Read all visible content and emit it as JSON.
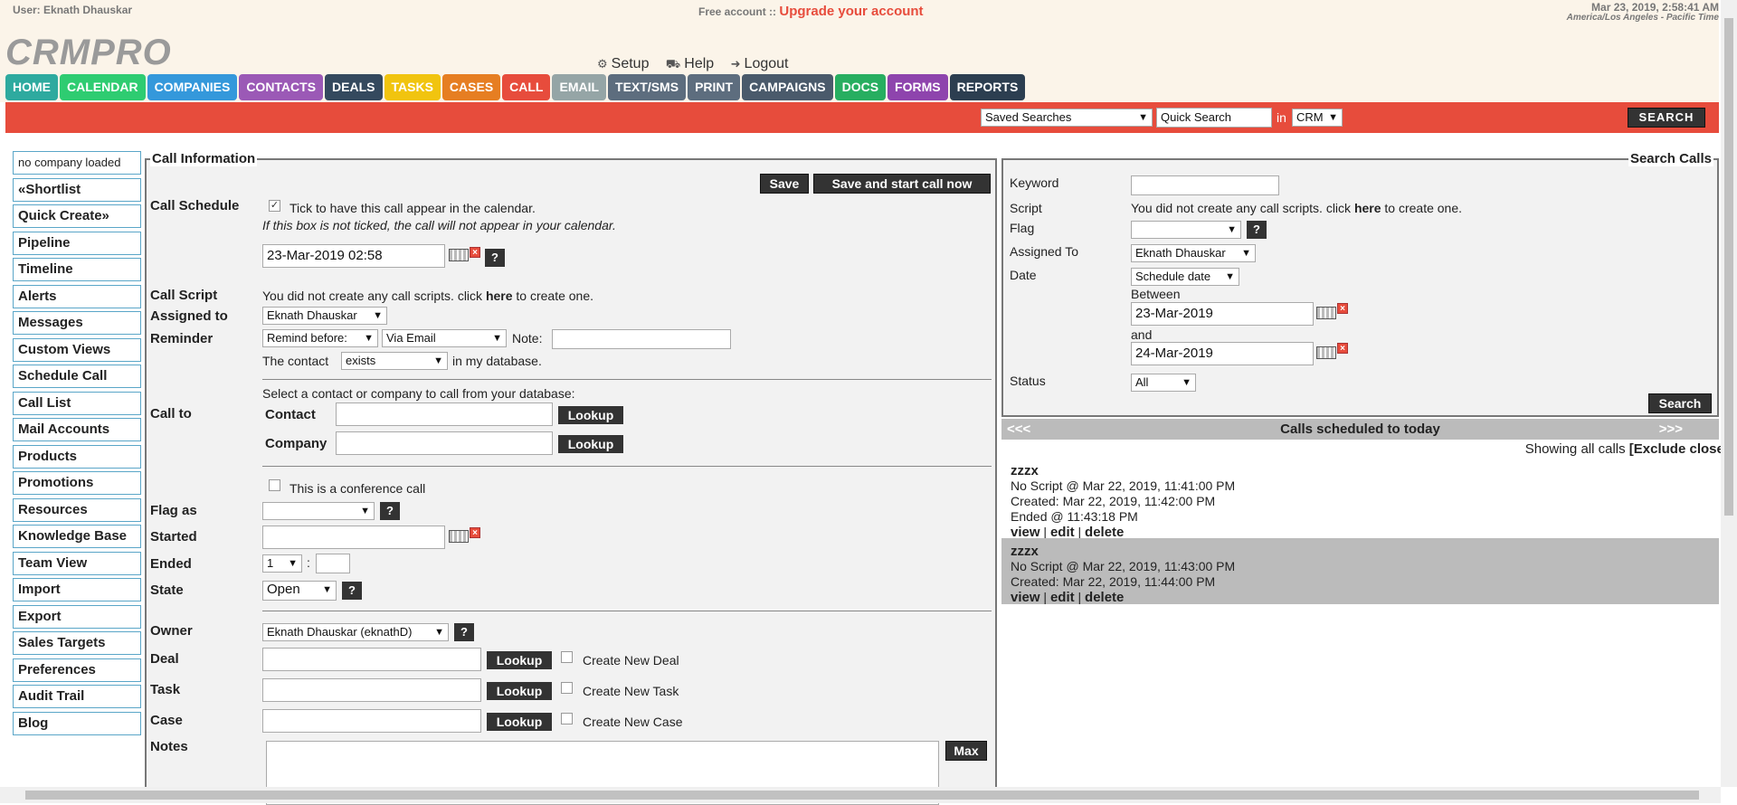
{
  "header": {
    "user": "User: Eknath Dhauskar",
    "free_account": "Free account ::",
    "upgrade": "Upgrade your account",
    "datetime": "Mar 23, 2019, 2:58:41 AM",
    "timezone": "America/Los Angeles - Pacific Time",
    "logo": "CRMPRO",
    "links": {
      "setup": "Setup",
      "help": "Help",
      "logout": "Logout"
    }
  },
  "nav": [
    {
      "label": "HOME",
      "color": "#2eaa9f"
    },
    {
      "label": "CALENDAR",
      "color": "#2ecc71"
    },
    {
      "label": "COMPANIES",
      "color": "#3498db"
    },
    {
      "label": "CONTACTS",
      "color": "#9b59b6"
    },
    {
      "label": "DEALS",
      "color": "#34495e"
    },
    {
      "label": "TASKS",
      "color": "#f1c40f"
    },
    {
      "label": "CASES",
      "color": "#e67e22"
    },
    {
      "label": "CALL",
      "color": "#e74c3c"
    },
    {
      "label": "EMAIL",
      "color": "#95a5a6"
    },
    {
      "label": "TEXT/SMS",
      "color": "#5d6d7e"
    },
    {
      "label": "PRINT",
      "color": "#5d6d7e"
    },
    {
      "label": "CAMPAIGNS",
      "color": "#4a5a6b"
    },
    {
      "label": "DOCS",
      "color": "#27ae60"
    },
    {
      "label": "FORMS",
      "color": "#8e44ad"
    },
    {
      "label": "REPORTS",
      "color": "#2c3e50"
    }
  ],
  "searchbar": {
    "saved_searches": "Saved Searches",
    "quick_search": "Quick Search",
    "in": "in",
    "scope": "CRM",
    "search_button": "SEARCH"
  },
  "leftmenu": [
    "no company loaded",
    "«Shortlist",
    "Quick Create»",
    "Pipeline",
    "Timeline",
    "Alerts",
    "Messages",
    "Custom Views",
    "Schedule Call",
    "Call List",
    "Mail Accounts",
    "Products",
    "Promotions",
    "Resources",
    "Knowledge Base",
    "Team View",
    "Import",
    "Export",
    "Sales Targets",
    "Preferences",
    "Audit Trail",
    "Blog"
  ],
  "call": {
    "title": "Call Information",
    "save": "Save",
    "save_start": "Save and start call now",
    "schedule_label": "Call Schedule",
    "schedule_tick": "Tick to have this call appear in the calendar.",
    "schedule_note": "If this box is not ticked, the call will not appear in your calendar.",
    "schedule_date": "23-Mar-2019 02:58",
    "script_label": "Call Script",
    "script_text_pre": "You did not create any call scripts. click",
    "script_here": "here",
    "script_text_post": "to create one.",
    "assigned_label": "Assigned to",
    "assigned_value": "Eknath Dhauskar",
    "reminder_label": "Reminder",
    "remind_before": "Remind before:",
    "via": "Via Email",
    "note": "Note:",
    "contact_pre": "The contact",
    "contact_exists": "exists",
    "contact_post": "in my database.",
    "callto_label": "Call to",
    "callto_hint": "Select a contact or company to call from your database:",
    "contact": "Contact",
    "company": "Company",
    "lookup": "Lookup",
    "conference": "This is a conference call",
    "flag_label": "Flag as",
    "started_label": "Started",
    "ended_label": "Ended",
    "ended_hour": "1",
    "colon": ":",
    "state_label": "State",
    "state_value": "Open",
    "owner_label": "Owner",
    "owner_value": "Eknath Dhauskar (eknathD)",
    "deal_label": "Deal",
    "task_label": "Task",
    "case_label": "Case",
    "create_deal": "Create New Deal",
    "create_task": "Create New Task",
    "create_case": "Create New Case",
    "notes_label": "Notes",
    "max": "Max",
    "q": "?"
  },
  "searchcalls": {
    "title": "Search Calls",
    "keyword": "Keyword",
    "script": "Script",
    "script_text_pre": "You did not create any call scripts. click",
    "script_here": "here",
    "script_text_post": "to create one.",
    "flag": "Flag",
    "assigned": "Assigned To",
    "assigned_value": "Eknath Dhauskar",
    "date": "Date",
    "date_type": "Schedule date",
    "between": "Between",
    "from": "23-Mar-2019",
    "and": "and",
    "to": "24-Mar-2019",
    "status": "Status",
    "status_value": "All",
    "search": "Search"
  },
  "calls": {
    "prev": "<<<",
    "next": ">>>",
    "title": "Calls scheduled to today",
    "showing": "Showing all calls",
    "exclude": "[Exclude closed]",
    "items": [
      {
        "title": "zzzx",
        "line1": "No Script @ Mar 22, 2019, 11:41:00 PM",
        "line2": "Created: Mar 22, 2019, 11:42:00 PM",
        "line3": "Ended @ 11:43:18 PM"
      },
      {
        "title": "zzzx",
        "line1": "No Script @ Mar 22, 2019, 11:43:00 PM",
        "line2": "Created: Mar 22, 2019, 11:44:00 PM"
      }
    ],
    "view": "view",
    "edit": "edit",
    "delete": "delete",
    "sep": "|"
  }
}
